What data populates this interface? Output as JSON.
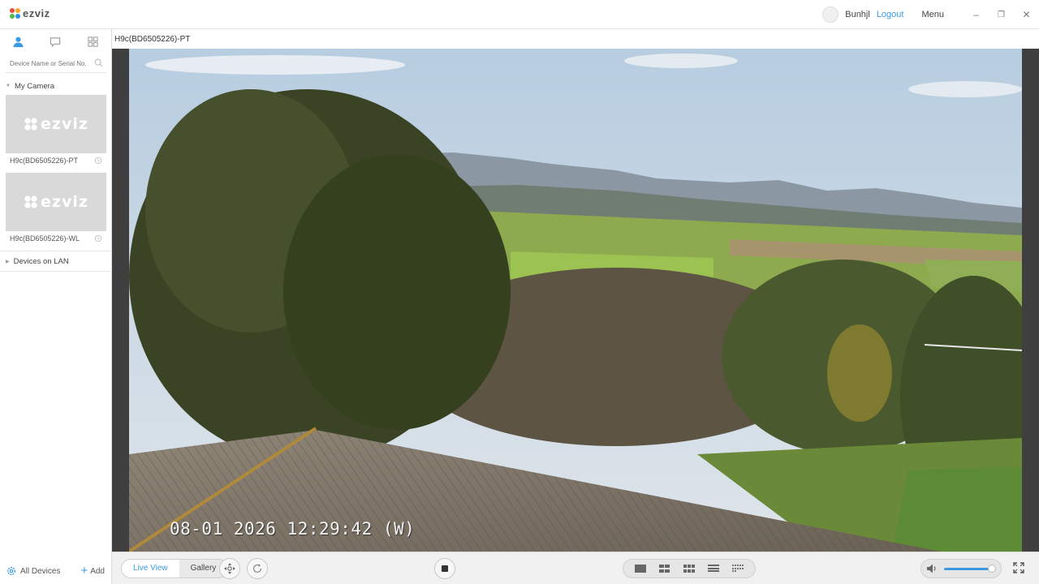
{
  "app": {
    "logo_text": "ezviz",
    "user_name": "Bunhjl",
    "logout_label": "Logout",
    "menu_label": "Menu",
    "window_controls": {
      "minimize": "–",
      "restore": "❐",
      "close": "✕"
    }
  },
  "sidebar": {
    "search_placeholder": "Device Name or Serial No.",
    "group_my_camera": "My Camera",
    "cameras": [
      {
        "thumb_logo": "ezviz",
        "name": "H9c(BD6505226)-PT"
      },
      {
        "thumb_logo": "ezviz",
        "name": "H9c(BD6505226)-WL"
      }
    ],
    "group_lan": "Devices on LAN",
    "all_devices_label": "All Devices",
    "add_label": "Add"
  },
  "main": {
    "channel_title": "H9c(BD6505226)-PT",
    "osd_timestamp": "08-01 2026 12:29:42  (W)"
  },
  "toolbar": {
    "live_view_label": "Live View",
    "gallery_label": "Gallery",
    "volume_level": 0.95
  },
  "colors": {
    "accent": "#3a9be0"
  }
}
